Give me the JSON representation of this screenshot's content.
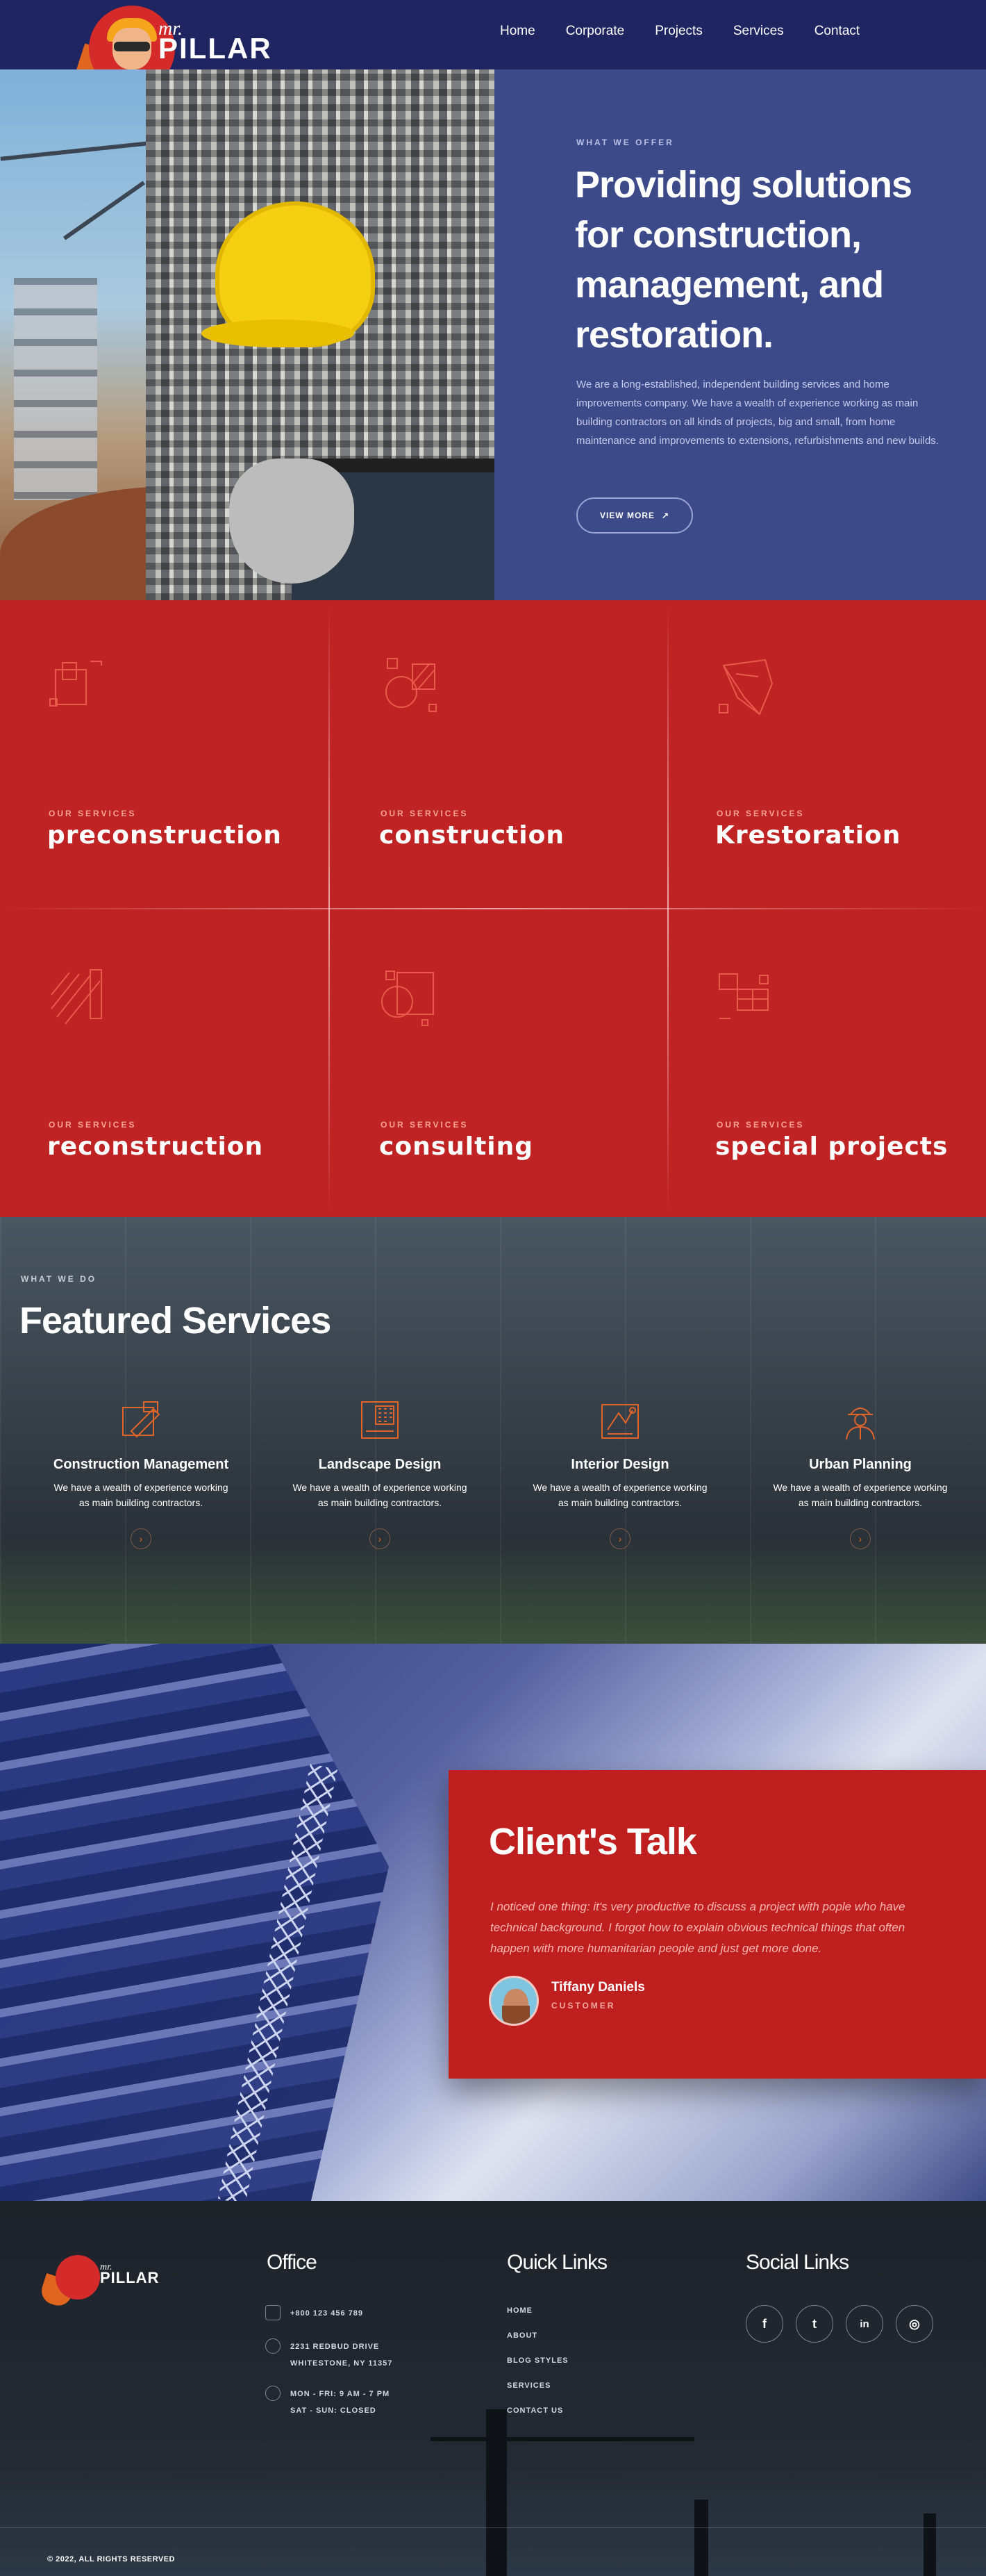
{
  "brand": {
    "prefix": "mr.",
    "name": "PILLAR"
  },
  "nav": {
    "items": [
      "Home",
      "Corporate",
      "Projects",
      "Services",
      "Contact"
    ]
  },
  "hero": {
    "eyebrow": "WHAT WE OFFER",
    "title": "Providing solutions for construction, management, and restoration.",
    "description": "We are a long-established, independent building services and home improvements company. We have a wealth of experience working as main building contractors on all kinds of projects, big and small, from home maintenance and improvements to extensions, refurbishments and new builds.",
    "button_label": "VIEW MORE",
    "button_icon": "arrow-up-right-icon"
  },
  "services": {
    "eyebrow": "OUR SERVICES",
    "items": [
      {
        "title": "preconstruction",
        "icon": "blueprint-icon"
      },
      {
        "title": "construction",
        "icon": "tools-icon"
      },
      {
        "title": "Krestoration",
        "icon": "restoration-icon"
      },
      {
        "title": "reconstruction",
        "icon": "hatch-icon"
      },
      {
        "title": "consulting",
        "icon": "shapes-icon"
      },
      {
        "title": "special projects",
        "icon": "grid-icon"
      }
    ],
    "accent_color": "#e85a4a"
  },
  "featured": {
    "eyebrow": "WHAT WE DO",
    "title": "Featured Services",
    "cards": [
      {
        "title": "Construction Management",
        "desc": "We have a wealth of experience working as main building contractors.",
        "icon": "trowel-icon"
      },
      {
        "title": "Landscape Design",
        "desc": "We have a wealth of experience working as main building contractors.",
        "icon": "grid-plan-icon"
      },
      {
        "title": "Interior Design",
        "desc": "We have a wealth of experience working as main building contractors.",
        "icon": "drafting-icon"
      },
      {
        "title": "Urban Planning",
        "desc": "We have a wealth of experience working as main building contractors.",
        "icon": "worker-icon"
      }
    ],
    "arrow": "›",
    "accent_color": "#e0652a"
  },
  "testimonial": {
    "title": "Client's Talk",
    "quote": "I noticed one thing: it's very productive to discuss a project with pople who have technical background. I forgot how to explain obvious technical things that often happen with more humanitarian people and just get more done.",
    "name": "Tiffany Daniels",
    "role": "CUSTOMER"
  },
  "footer": {
    "office": {
      "title": "Office",
      "phone": "+800 123 456 789",
      "address_line1": "2231 REDBUD DRIVE",
      "address_line2": "WHITESTONE, NY 11357",
      "hours_line1": "MON - FRI: 9 AM - 7 PM",
      "hours_line2": "SAT - SUN: CLOSED"
    },
    "quick_links": {
      "title": "Quick Links",
      "items": [
        "HOME",
        "ABOUT",
        "BLOG STYLES",
        "SERVICES",
        "CONTACT US"
      ]
    },
    "social": {
      "title": "Social Links",
      "items": [
        {
          "name": "facebook-icon",
          "glyph": "f"
        },
        {
          "name": "twitter-icon",
          "glyph": "t"
        },
        {
          "name": "linkedin-icon",
          "glyph": "in"
        },
        {
          "name": "instagram-icon",
          "glyph": "◎"
        }
      ]
    },
    "copyright": "© 2022, ALL RIGHTS RESERVED"
  }
}
